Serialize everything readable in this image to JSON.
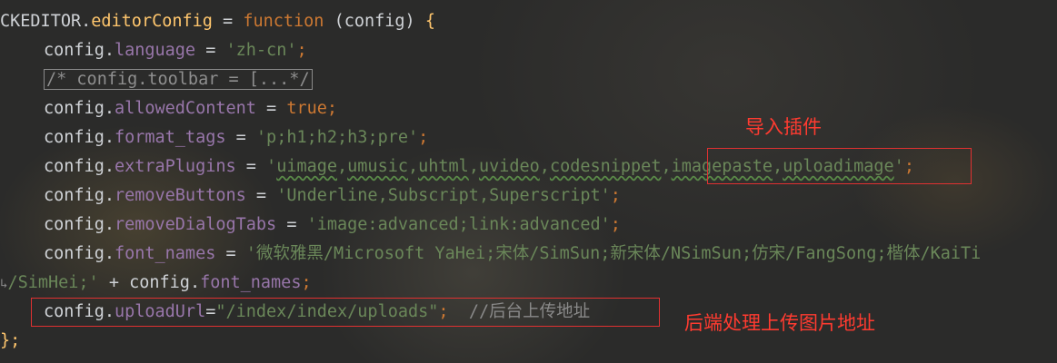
{
  "code": {
    "l1": {
      "obj": "CKEDITOR",
      "dot": ".",
      "prop": "editorConfig",
      "eq": " = ",
      "kw": "function",
      "params": " (config) ",
      "brace": "{"
    },
    "l2": {
      "obj": "config",
      "prop": "language",
      "eq": " = ",
      "str": "'zh-cn'",
      "end": ";"
    },
    "l3": {
      "comment": "/* config.toolbar = [...*/"
    },
    "l4": {
      "obj": "config",
      "prop": "allowedContent",
      "eq": " = ",
      "kw": "true",
      "end": ";"
    },
    "l5": {
      "obj": "config",
      "prop": "format_tags",
      "eq": " = ",
      "str": "'p;h1;h2;h3;pre'",
      "end": ";"
    },
    "l6": {
      "obj": "config",
      "prop": "extraPlugins",
      "eq": " = ",
      "q": "'",
      "p1": "uimage",
      "c1": ",",
      "p2": "umusic",
      "c2": ",",
      "p3": "uhtml",
      "c3": ",",
      "p4": "uvideo",
      "c4": ",",
      "p5": "codesnippet",
      "c5": ",",
      "p6": "imagepaste",
      "c6": ",",
      "p7": "uploadimage",
      "q2": "'",
      "end": ";"
    },
    "l7": {
      "obj": "config",
      "prop": "removeButtons",
      "eq": " = ",
      "str": "'Underline,Subscript,Superscript'",
      "end": ";"
    },
    "l8": {
      "obj": "config",
      "prop": "removeDialogTabs",
      "eq": " = ",
      "str": "'image:advanced;link:advanced'",
      "end": ";"
    },
    "l9": {
      "obj": "config",
      "prop": "font_names",
      "eq": " = ",
      "str": "'微软雅黑/Microsoft YaHei;宋体/SimSun;新宋体/NSimSun;仿宋/FangSong;楷体/KaiTi"
    },
    "l10": {
      "wrap": "↳",
      "str": "/SimHei;'",
      "plus": " + ",
      "obj": "config",
      "prop": "font_names",
      "end": ";"
    },
    "l11": {
      "obj": "config",
      "prop": "uploadUrl",
      "eq": "=",
      "str": "\"/index/index/uploads\"",
      "end": ";",
      "comment": "  //后台上传地址"
    },
    "l12": {
      "close": "};"
    }
  },
  "annotations": {
    "plugins_note": "导入插件",
    "upload_note": "后端处理上传图片地址"
  },
  "colors": {
    "keyword": "#cc7832",
    "function": "#ffc66d",
    "property": "#9876aa",
    "string": "#6a8759",
    "annotation": "#ff3b30"
  }
}
